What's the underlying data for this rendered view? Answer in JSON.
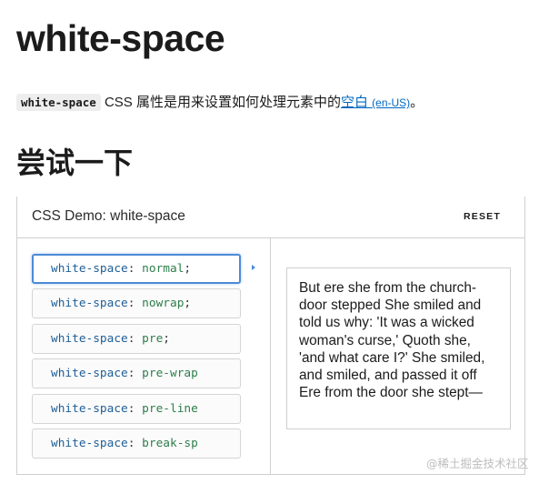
{
  "page": {
    "title": "white-space",
    "intro": {
      "code": "white-space",
      "text": " CSS 属性是用来设置如何处理元素中的",
      "link_text": "空白 ",
      "link_lang": "(en-US)",
      "tail": "。"
    },
    "section_title": "尝试一下"
  },
  "demo": {
    "title": "CSS Demo: white-space",
    "reset_label": "RESET",
    "choices": [
      {
        "property": "white-space",
        "colon": ": ",
        "value": "normal",
        "semi": ";"
      },
      {
        "property": "white-space",
        "colon": ": ",
        "value": "nowrap",
        "semi": ";"
      },
      {
        "property": "white-space",
        "colon": ": ",
        "value": "pre",
        "semi": ";"
      },
      {
        "property": "white-space",
        "colon": ": ",
        "value": "pre-wrap",
        "semi": ""
      },
      {
        "property": "white-space",
        "colon": ": ",
        "value": "pre-line",
        "semi": ""
      },
      {
        "property": "white-space",
        "colon": ": ",
        "value": "break-sp",
        "semi": ""
      }
    ],
    "selected_index": 0,
    "output_text": "But ere she from the church-door stepped She smiled and told us why: 'It was a wicked woman's curse,' Quoth she, 'and what care I?' She smiled, and smiled, and passed it off Ere from the door she stept—"
  },
  "watermark": "@稀土掘金技术社区",
  "colors": {
    "link": "#0069c2",
    "selected_border": "#4d8ad6",
    "property": "#1f5e96",
    "value": "#2d7d4a"
  }
}
